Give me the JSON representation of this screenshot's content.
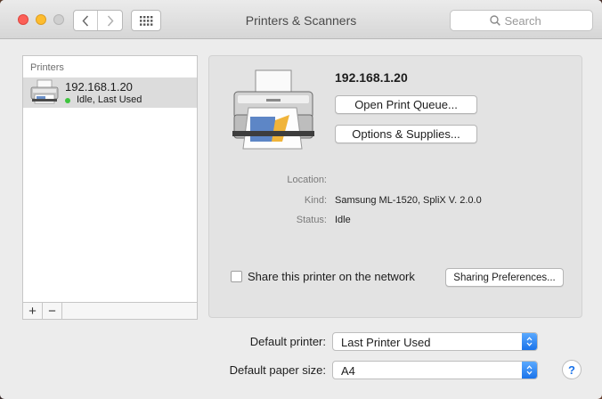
{
  "window": {
    "title": "Printers & Scanners"
  },
  "toolbar": {
    "back_icon": "chevron-left-icon",
    "forward_icon": "chevron-right-icon",
    "grid_icon": "grid-icon",
    "search_placeholder": "Search"
  },
  "sidebar": {
    "header": "Printers",
    "items": [
      {
        "name": "192.168.1.20",
        "status": "Idle, Last Used",
        "status_color": "#3ec43e",
        "icon": "printer-icon"
      }
    ],
    "add_label": "+",
    "remove_label": "−"
  },
  "detail": {
    "printer_name": "192.168.1.20",
    "open_queue_label": "Open Print Queue...",
    "options_label": "Options & Supplies...",
    "location_label": "Location:",
    "location_value": "",
    "kind_label": "Kind:",
    "kind_value": "Samsung ML-1520, SpliX V. 2.0.0",
    "status_label": "Status:",
    "status_value": "Idle",
    "share_label": "Share this printer on the network",
    "share_checked": false,
    "sharing_prefs_label": "Sharing Preferences..."
  },
  "defaults": {
    "default_printer_label": "Default printer:",
    "default_printer_value": "Last Printer Used",
    "paper_size_label": "Default paper size:",
    "paper_size_value": "A4",
    "help_label": "?"
  },
  "colors": {
    "accent": "#1a73ea",
    "selection": "#dcdcdc"
  }
}
